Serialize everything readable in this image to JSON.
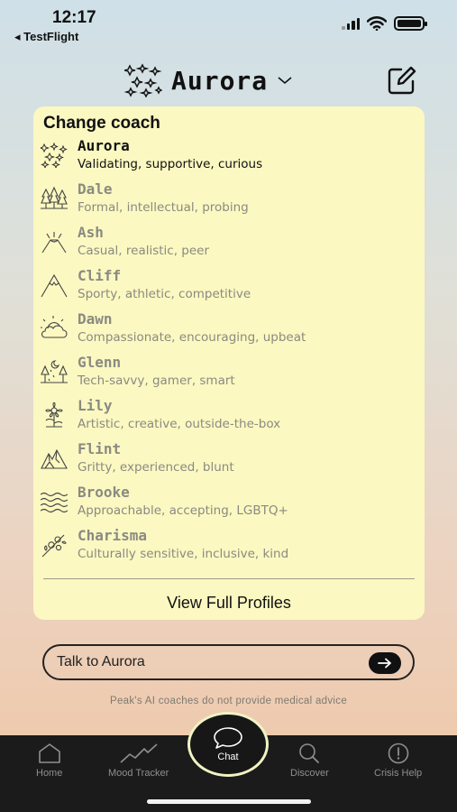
{
  "status_bar": {
    "time": "12:17",
    "back_label": "◂ TestFlight",
    "icons": [
      "signal-icon",
      "wifi-icon",
      "battery-icon"
    ]
  },
  "header": {
    "current_coach": "Aurora",
    "icons": [
      "aurora-sparkle-icon",
      "chevron-down-icon",
      "compose-icon"
    ]
  },
  "dropdown": {
    "title": "Change coach",
    "coaches": [
      {
        "name": "Aurora",
        "desc": "Validating, supportive, curious",
        "icon": "sparkles-icon",
        "selected": true
      },
      {
        "name": "Dale",
        "desc": "Formal, intellectual, probing",
        "icon": "forest-icon",
        "selected": false
      },
      {
        "name": "Ash",
        "desc": "Casual, realistic, peer",
        "icon": "volcano-icon",
        "selected": false
      },
      {
        "name": "Cliff",
        "desc": "Sporty, athletic, competitive",
        "icon": "mountain-icon",
        "selected": false
      },
      {
        "name": "Dawn",
        "desc": "Compassionate, encouraging, upbeat",
        "icon": "sun-cloud-icon",
        "selected": false
      },
      {
        "name": "Glenn",
        "desc": "Tech-savvy, gamer, smart",
        "icon": "night-trees-icon",
        "selected": false
      },
      {
        "name": "Lily",
        "desc": "Artistic, creative, outside-the-box",
        "icon": "flower-icon",
        "selected": false
      },
      {
        "name": "Flint",
        "desc": "Gritty, experienced, blunt",
        "icon": "rocky-peaks-icon",
        "selected": false
      },
      {
        "name": "Brooke",
        "desc": "Approachable, accepting, LGBTQ+",
        "icon": "waves-icon",
        "selected": false
      },
      {
        "name": "Charisma",
        "desc": "Culturally sensitive, inclusive, kind",
        "icon": "blossom-branch-icon",
        "selected": false
      }
    ],
    "view_full_profiles": "View Full Profiles"
  },
  "chat_input": {
    "placeholder": "Talk to Aurora",
    "send_icon": "arrow-right-icon"
  },
  "disclaimer": "Peak's AI coaches do not provide medical advice",
  "tab_bar": {
    "home": "Home",
    "mood_tracker": "Mood Tracker",
    "chat": "Chat",
    "discover": "Discover",
    "crisis_help": "Crisis Help"
  },
  "colors": {
    "dropdown_bg": "#fbf8c1",
    "tab_bar_bg": "#1b1b1b",
    "chat_ring": "#f0f3c3",
    "muted_text": "#8a8a82"
  }
}
